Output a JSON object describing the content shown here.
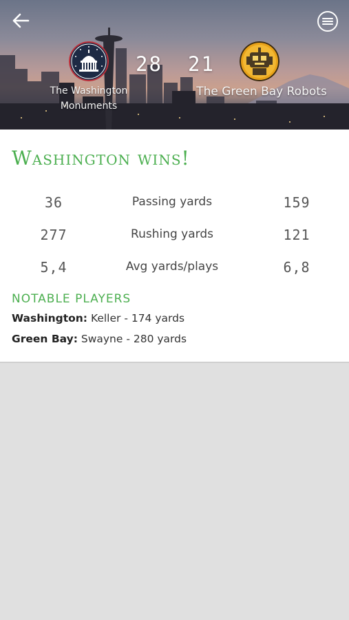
{
  "header": {
    "back_icon": "arrow-left-icon",
    "menu_icon": "hamburger-menu-icon"
  },
  "game": {
    "home": {
      "name": "The Washington Monuments",
      "score": "28",
      "logo_icon": "capitol-dome-icon",
      "logo_color": "#1d2a44"
    },
    "away": {
      "name": "The Green Bay Robots",
      "score": "21",
      "logo_icon": "robot-icon",
      "logo_color": "#e8a21a"
    }
  },
  "result": {
    "headline": "Washington wins!",
    "accent_color": "#4caf50"
  },
  "stats": [
    {
      "home": "36",
      "label": "Passing yards",
      "away": "159"
    },
    {
      "home": "277",
      "label": "Rushing yards",
      "away": "121"
    },
    {
      "home": "5,4",
      "label": "Avg yards/plays",
      "away": "6,8"
    }
  ],
  "notable": {
    "title": "NOTABLE PLAYERS",
    "players": [
      {
        "team": "Washington:",
        "detail": "Keller - 174 yards"
      },
      {
        "team": "Green Bay:",
        "detail": "Swayne - 280 yards"
      }
    ]
  }
}
